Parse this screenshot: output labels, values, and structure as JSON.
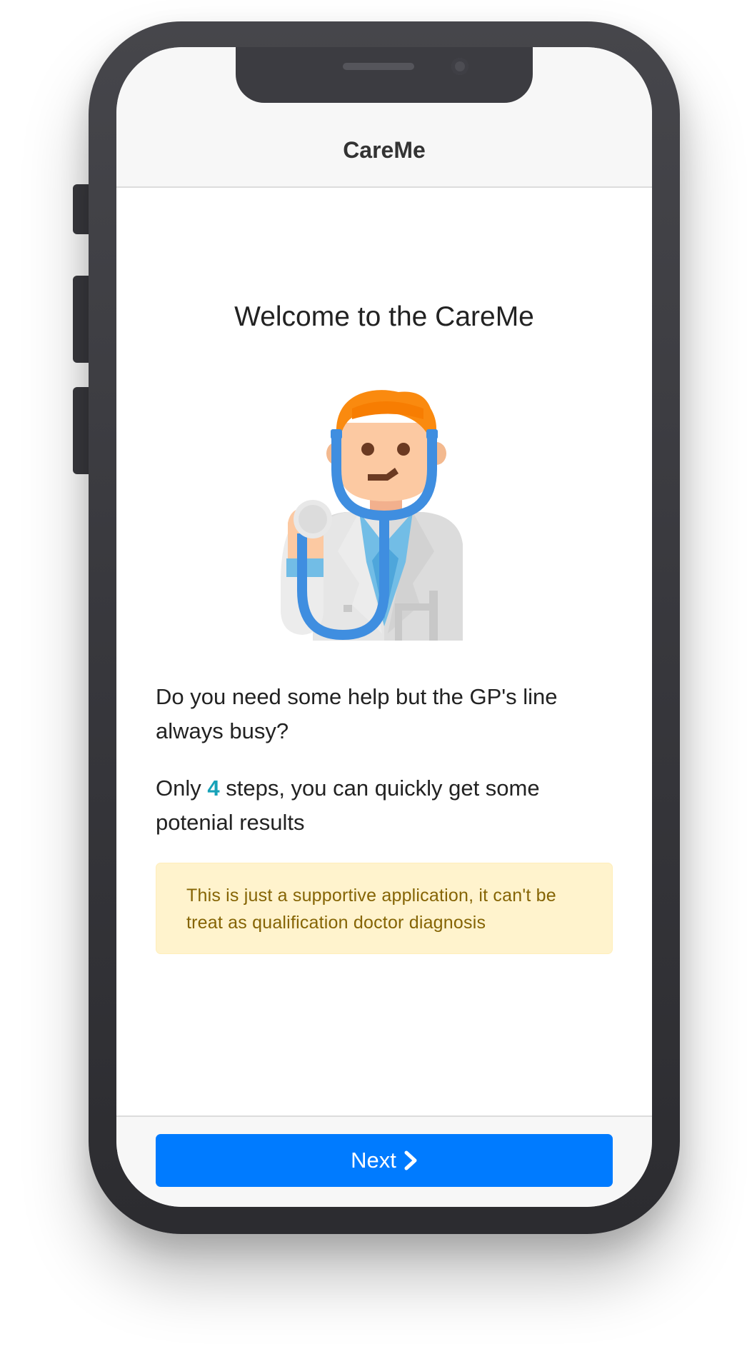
{
  "app": {
    "title": "CareMe"
  },
  "welcome": {
    "heading": "Welcome to the CareMe",
    "illustration_icon": "doctor-with-stethoscope-icon"
  },
  "intro": {
    "question": "Do you need some help but the GP's line always busy?",
    "steps_prefix": "Only ",
    "steps_count": "4",
    "steps_suffix": " steps, you can quickly get some potenial results"
  },
  "disclaimer": {
    "text": "This is just a supportive application, it can't be treat as qualification doctor diagnosis"
  },
  "footer": {
    "next_label": "Next",
    "next_icon": "chevron-right-icon"
  },
  "colors": {
    "primary": "#007bff",
    "highlight": "#17a2b8",
    "alert_bg": "#fff3cd",
    "alert_text": "#856404",
    "navbar_bg": "#f7f7f7",
    "phone_frame": "#3a3a3f"
  }
}
